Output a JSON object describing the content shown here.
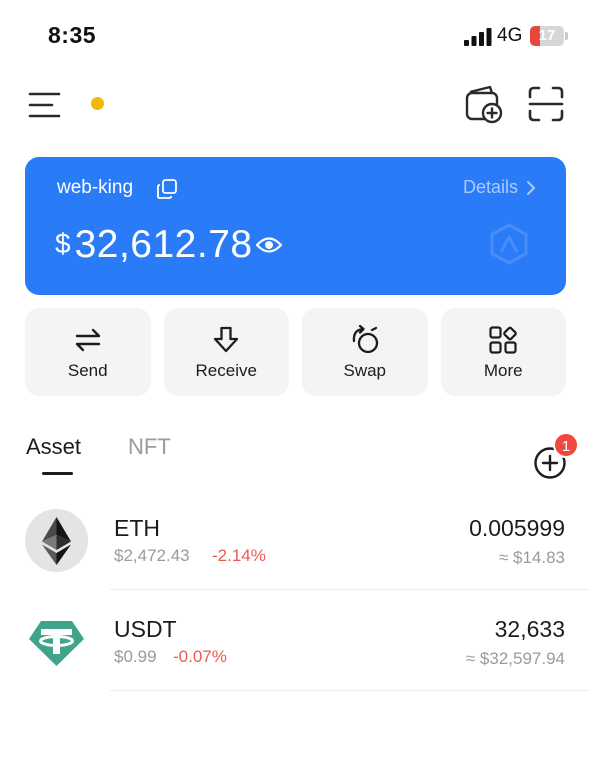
{
  "status_bar": {
    "time": "8:35",
    "network": "4G",
    "battery": "17",
    "battery_level": 0.17,
    "battery_color": "#e8463c"
  },
  "header": {
    "menu_icon": "menu-icon",
    "online_dot_color": "#f0b90b",
    "wallet_add_icon": "wallet-add-icon",
    "scan_icon": "scan-icon"
  },
  "wallet": {
    "name": "web-king",
    "details_label": "Details",
    "currency_symbol": "$",
    "balance": "32,612.78",
    "card_color": "#2a7bf7"
  },
  "actions": [
    {
      "label": "Send",
      "icon": "transfer-arrows-icon"
    },
    {
      "label": "Receive",
      "icon": "download-arrow-icon"
    },
    {
      "label": "Swap",
      "icon": "swap-icon"
    },
    {
      "label": "More",
      "icon": "grid-icon"
    }
  ],
  "tabs": {
    "asset": "Asset",
    "nft": "NFT",
    "badge_count": "1"
  },
  "tokens": [
    {
      "symbol": "ETH",
      "price": "$2,472.43",
      "change": "-2.14%",
      "amount": "0.005999",
      "value": "≈ $14.83",
      "icon": "ethereum-logo-icon"
    },
    {
      "symbol": "USDT",
      "price": "$0.99",
      "change": "-0.07%",
      "amount": "32,633",
      "value": "≈ $32,597.94",
      "icon": "tether-logo-icon"
    }
  ],
  "colors": {
    "negative": "#ee5a4f",
    "muted": "#9a9aa0",
    "tether": "#3fa48a"
  }
}
